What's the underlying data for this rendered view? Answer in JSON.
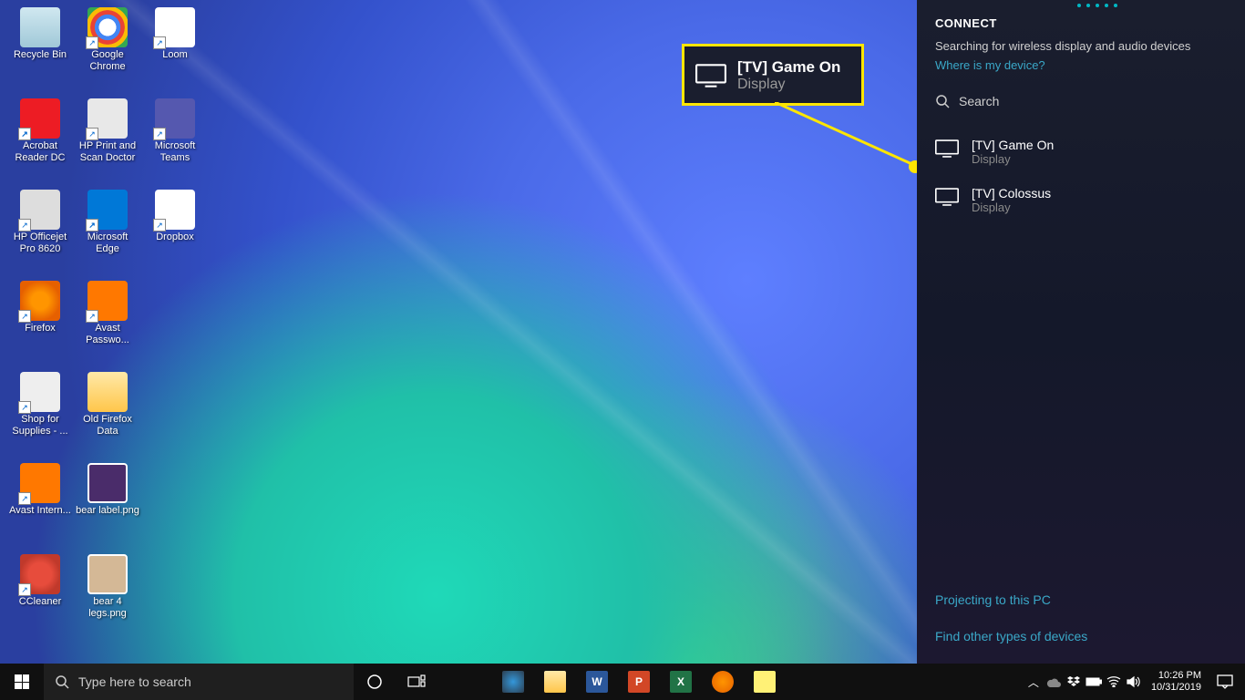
{
  "desktop_icons": [
    {
      "label": "Recycle Bin",
      "glyph": "recycle",
      "shortcut": false
    },
    {
      "label": "Google Chrome",
      "glyph": "chrome",
      "shortcut": true
    },
    {
      "label": "Loom",
      "glyph": "loom",
      "shortcut": true
    },
    {
      "label": "Acrobat Reader DC",
      "glyph": "adobe",
      "shortcut": true
    },
    {
      "label": "HP Print and Scan Doctor",
      "glyph": "hpbox",
      "shortcut": true
    },
    {
      "label": "Microsoft Teams",
      "glyph": "teams",
      "shortcut": true
    },
    {
      "label": "HP Officejet Pro 8620",
      "glyph": "printer",
      "shortcut": true
    },
    {
      "label": "Microsoft Edge",
      "glyph": "edge",
      "shortcut": true
    },
    {
      "label": "Dropbox",
      "glyph": "dropbox",
      "shortcut": true
    },
    {
      "label": "Firefox",
      "glyph": "firefox",
      "shortcut": true
    },
    {
      "label": "Avast Passwo...",
      "glyph": "avastpw",
      "shortcut": true
    },
    {
      "label": "",
      "glyph": "",
      "shortcut": false
    },
    {
      "label": "Shop for Supplies - ...",
      "glyph": "shopsup",
      "shortcut": true
    },
    {
      "label": "Old Firefox Data",
      "glyph": "folder",
      "shortcut": false
    },
    {
      "label": "",
      "glyph": "",
      "shortcut": false
    },
    {
      "label": "Avast Intern...",
      "glyph": "avastnet",
      "shortcut": true
    },
    {
      "label": "bear label.png",
      "glyph": "imgfile",
      "shortcut": false
    },
    {
      "label": "",
      "glyph": "",
      "shortcut": false
    },
    {
      "label": "CCleaner",
      "glyph": "ccleaner",
      "shortcut": true
    },
    {
      "label": "bear 4 legs.png",
      "glyph": "bearimg",
      "shortcut": false
    }
  ],
  "connect": {
    "title": "CONNECT",
    "searching": "Searching for wireless display and audio devices",
    "where_link": "Where is my device?",
    "search_label": "Search",
    "devices": [
      {
        "name": "[TV] Game On",
        "type": "Display"
      },
      {
        "name": "[TV] Colossus",
        "type": "Display"
      }
    ],
    "projecting_link": "Projecting to this PC",
    "find_other_link": "Find other types of devices"
  },
  "callout": {
    "name": "[TV] Game On",
    "type": "Display"
  },
  "taskbar": {
    "search_placeholder": "Type here to search",
    "pinned": [
      "cortana",
      "taskview",
      "snagit",
      "explorer",
      "word",
      "powerpoint",
      "excel",
      "firefox",
      "stickynotes"
    ],
    "tray": [
      "chevron-up",
      "onedrive",
      "dropbox",
      "battery",
      "wifi",
      "volume"
    ],
    "time": "10:26 PM",
    "date": "10/31/2019"
  }
}
